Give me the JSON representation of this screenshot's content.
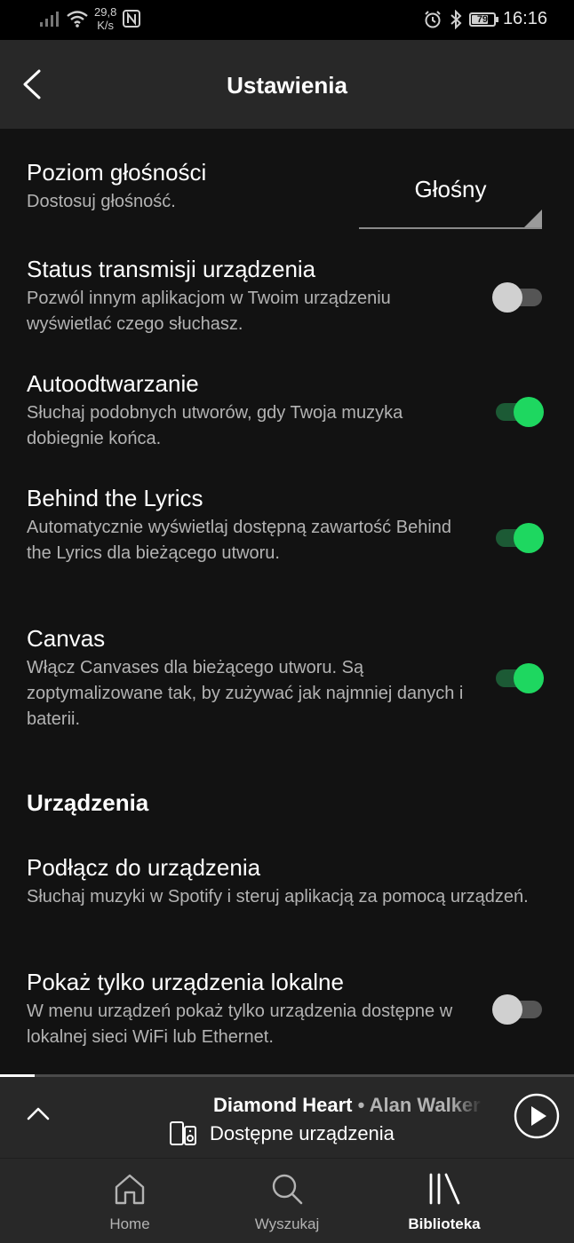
{
  "status_bar": {
    "network_speed_value": "29,8",
    "network_speed_unit": "K/s",
    "battery": "79",
    "battery_level": 0.79,
    "time": "16:16"
  },
  "header": {
    "title": "Ustawienia"
  },
  "settings": {
    "volume": {
      "title": "Poziom głośności",
      "description": "Dostosuj głośność.",
      "value": "Głośny"
    },
    "device_broadcast": {
      "title": "Status transmisji urządzenia",
      "description": "Pozwól innym aplikacjom w Twoim urządzeniu wyświetlać czego słuchasz.",
      "enabled": false
    },
    "autoplay": {
      "title": "Autoodtwarzanie",
      "description": "Słuchaj podobnych utworów, gdy Twoja muzyka dobiegnie końca.",
      "enabled": true
    },
    "behind_lyrics": {
      "title": "Behind the Lyrics",
      "description": "Automatycznie wyświetlaj dostępną zawartość Behind the Lyrics dla bieżącego utworu.",
      "enabled": true
    },
    "canvas": {
      "title": "Canvas",
      "description": "Włącz Canvases dla bieżącego utworu. Są zoptymalizowane tak, by zużywać jak najmniej danych i baterii.",
      "enabled": true
    }
  },
  "devices_section": {
    "title": "Urządzenia",
    "connect": {
      "title": "Podłącz do urządzenia",
      "description": "Słuchaj muzyki w Spotify i steruj aplikacją za pomocą urządzeń."
    },
    "local_only": {
      "title": "Pokaż tylko urządzenia lokalne",
      "description": "W menu urządzeń pokaż tylko urządzenia dostępne w lokalnej sieci WiFi lub Ethernet.",
      "enabled": false
    }
  },
  "now_playing": {
    "track": "Diamond Heart",
    "separator": " • ",
    "artist": "Alan Walker",
    "devices_label": "Dostępne urządzenia",
    "progress": 0.06
  },
  "nav": {
    "items": [
      {
        "label": "Home",
        "icon": "home-icon",
        "active": false
      },
      {
        "label": "Wyszukaj",
        "icon": "search-icon",
        "active": false
      },
      {
        "label": "Biblioteka",
        "icon": "library-icon",
        "active": true
      }
    ]
  },
  "colors": {
    "accent": "#1ed760",
    "background": "#121212",
    "surface": "#282828",
    "secondary_text": "#b3b3b3"
  }
}
